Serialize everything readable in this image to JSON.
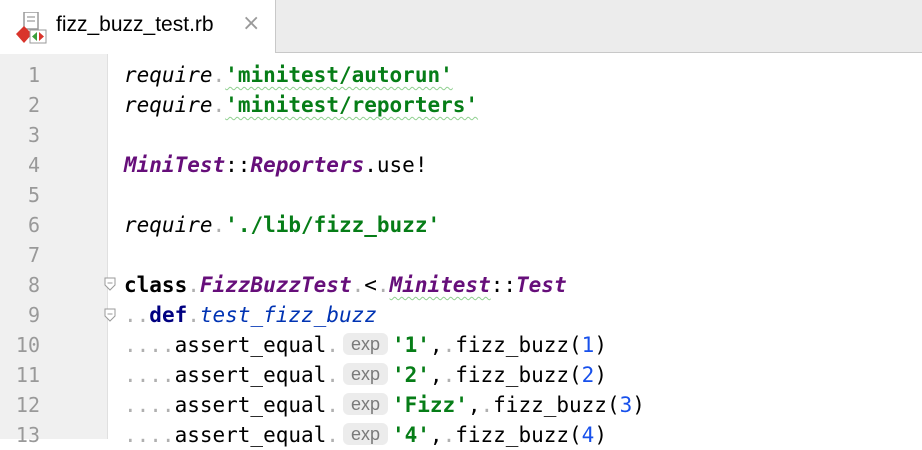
{
  "tab": {
    "filename": "fizz_buzz_test.rb",
    "close_symbol": "×",
    "file_icon": "ruby-test-file-icon"
  },
  "gutter": {
    "line_numbers": [
      "1",
      "2",
      "3",
      "4",
      "5",
      "6",
      "7",
      "8",
      "9",
      "10",
      "11",
      "12",
      "13"
    ]
  },
  "code": {
    "l1_kw": "require",
    "l1_str": "'minitest/autorun'",
    "l2_kw": "require",
    "l2_str": "'minitest/reporters'",
    "l4_const1": "MiniTest",
    "l4_sep": "::",
    "l4_const2": "Reporters",
    "l4_call": ".use!",
    "l6_kw": "require",
    "l6_str": "'./lib/fizz_buzz'",
    "l8_kw": "class",
    "l8_name": "FizzBuzzTest",
    "l8_lt": "<",
    "l8_const1": "Minitest",
    "l8_sep": "::",
    "l8_const2": "Test",
    "l9_kw": "def",
    "l9_name": "test_fizz_buzz",
    "assert_method": "assert_equal",
    "hint_label": "exp",
    "fizz_call": "fizz_buzz(",
    "paren_close": ")",
    "comma": ",",
    "l10_str": "'1'",
    "l10_num": "1",
    "l11_str": "'2'",
    "l11_num": "2",
    "l12_str": "'Fizz'",
    "l12_num": "3",
    "l13_str": "'4'",
    "l13_num": "4"
  },
  "colors": {
    "string": "#067d17",
    "constant": "#660e7a",
    "keyword": "#000080",
    "number": "#1750eb"
  }
}
